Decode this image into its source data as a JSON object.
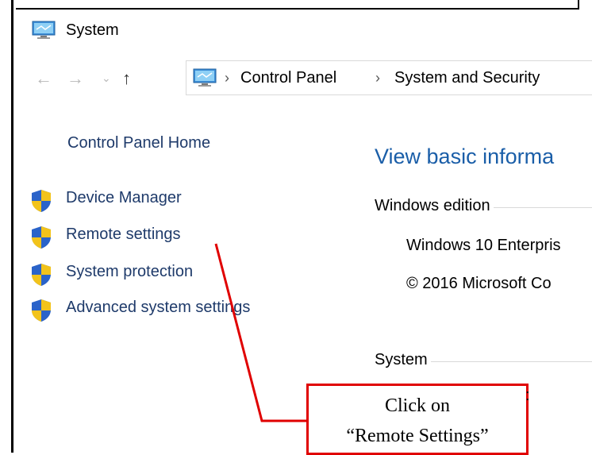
{
  "window": {
    "title": "System"
  },
  "nav": {
    "back_icon": "back-arrow",
    "forward_icon": "forward-arrow",
    "recent_icon": "chevron-down",
    "up_icon": "up-arrow",
    "breadcrumb": [
      "Control Panel",
      "System and Security"
    ]
  },
  "left_pane": {
    "home_link": "Control Panel Home",
    "links": [
      {
        "label": "Device Manager",
        "icon": "shield-icon"
      },
      {
        "label": "Remote settings",
        "icon": "shield-icon"
      },
      {
        "label": "System protection",
        "icon": "shield-icon"
      },
      {
        "label": "Advanced system settings",
        "icon": "shield-icon"
      }
    ]
  },
  "main": {
    "heading": "View basic informa",
    "windows_edition": {
      "label": "Windows edition",
      "values": [
        "Windows 10 Enterpris",
        "© 2016 Microsoft Co"
      ]
    },
    "system": {
      "label": "System",
      "partial": ":"
    }
  },
  "annotation": {
    "callout_lines": [
      "Click on",
      "“Remote Settings”"
    ],
    "color": "#e00000"
  }
}
